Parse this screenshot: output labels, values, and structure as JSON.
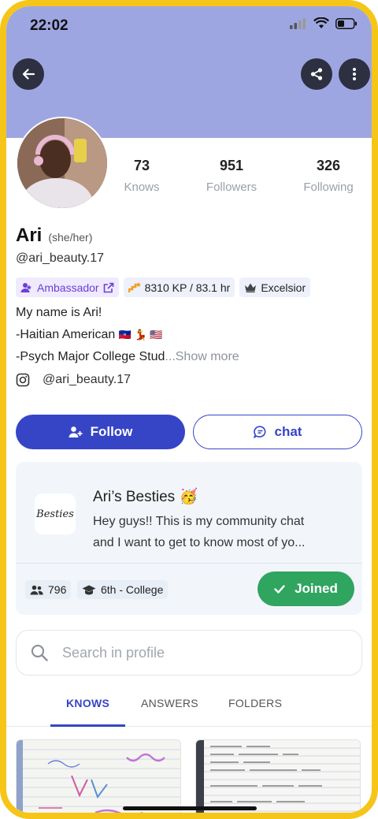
{
  "status_bar": {
    "time": "22:02"
  },
  "profile": {
    "name": "Ari",
    "pronouns": "(she/her)",
    "handle": "@ari_beauty.17",
    "stats": [
      {
        "value": "73",
        "label": "Knows"
      },
      {
        "value": "951",
        "label": "Followers"
      },
      {
        "value": "326",
        "label": "Following"
      }
    ],
    "badges": {
      "ambassador": "Ambassador",
      "kp": "8310 KP / 83.1 hr",
      "rank": "Excelsior"
    },
    "bio": {
      "line1": "My name is Ari!",
      "line2": "-Haitian American",
      "line2_flags": "🇭🇹 💃 🇺🇸",
      "line3": "-Psych Major College Stud",
      "show_more": "...Show more"
    },
    "instagram": "@ari_beauty.17"
  },
  "actions": {
    "follow": "Follow",
    "chat": "chat"
  },
  "community": {
    "logo_text": "Besties",
    "title": "Ari’s Besties 🥳",
    "description_line1": "Hey guys!! This is my community chat",
    "description_line2": "and I want to get to know most of yo...",
    "members": "796",
    "grade": "6th - College",
    "joined_label": "Joined"
  },
  "search": {
    "placeholder": "Search in profile"
  },
  "tabs": [
    {
      "label": "KNOWS",
      "active": true
    },
    {
      "label": "ANSWERS",
      "active": false
    },
    {
      "label": "FOLDERS",
      "active": false
    }
  ],
  "colors": {
    "header": "#9ea6e2",
    "primary": "#3545c6",
    "joined": "#2fa55f",
    "ambassador": "#6b3fd6",
    "frame": "#f5c518"
  }
}
